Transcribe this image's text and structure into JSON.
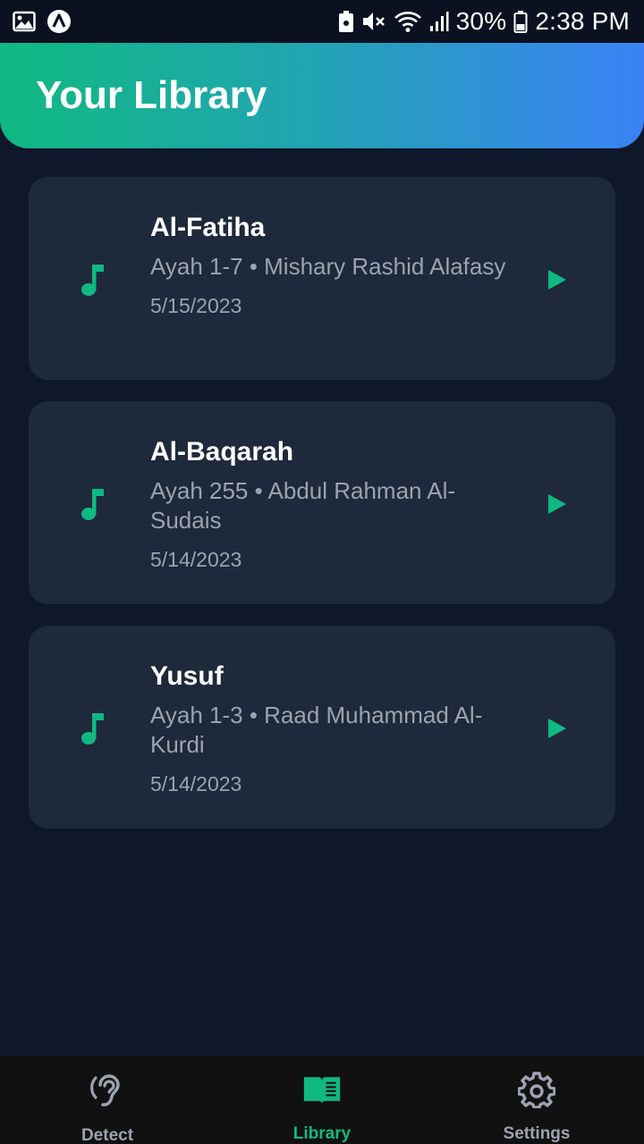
{
  "status_bar": {
    "battery": "30%",
    "time": "2:38 PM",
    "icons": [
      "image-icon",
      "app-a-icon",
      "lock-box-icon",
      "mute-icon",
      "wifi-icon",
      "signal-icon",
      "battery-icon"
    ]
  },
  "header": {
    "title": "Your Library"
  },
  "library": {
    "items": [
      {
        "title": "Al-Fatiha",
        "subtitle": "Ayah 1-7 • Mishary Rashid Alafasy",
        "date": "5/15/2023"
      },
      {
        "title": "Al-Baqarah",
        "subtitle": "Ayah 255 • Abdul Rahman Al-Sudais",
        "date": "5/14/2023"
      },
      {
        "title": "Yusuf",
        "subtitle": "Ayah 1-3 • Raad Muhammad Al-Kurdi",
        "date": "5/14/2023"
      }
    ]
  },
  "nav": {
    "detect": "Detect",
    "library": "Library",
    "settings": "Settings",
    "active": "library"
  },
  "colors": {
    "background": "#0f172a",
    "card": "#1e293b",
    "accent": "#10b981",
    "gradient_end": "#3b82f6",
    "muted_text": "#9ca3af",
    "nav_inactive": "#9ca3af"
  }
}
